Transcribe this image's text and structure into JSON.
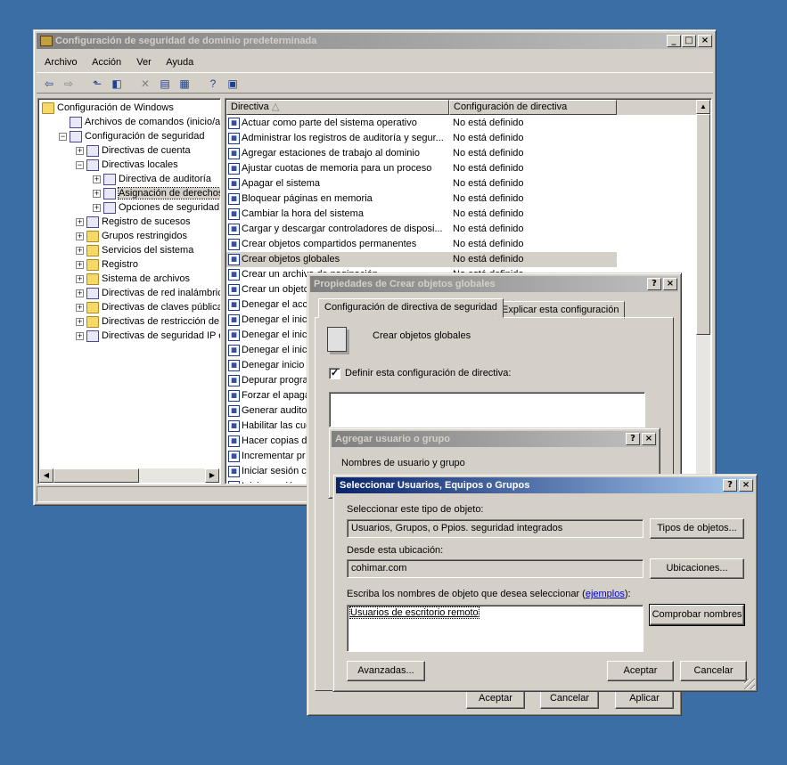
{
  "main": {
    "title": "Configuración de seguridad de dominio predeterminada",
    "menu": [
      "Archivo",
      "Acción",
      "Ver",
      "Ayuda"
    ],
    "tree": [
      {
        "label": "Configuración de Windows",
        "level": 0,
        "exp": "",
        "icon": "folder"
      },
      {
        "label": "Archivos de comandos (inicio/apa",
        "level": 1,
        "exp": "",
        "icon": "doc"
      },
      {
        "label": "Configuración de seguridad",
        "level": 1,
        "exp": "−",
        "icon": "policy"
      },
      {
        "label": "Directivas de cuenta",
        "level": 2,
        "exp": "+",
        "icon": "policy"
      },
      {
        "label": "Directivas locales",
        "level": 2,
        "exp": "−",
        "icon": "policy"
      },
      {
        "label": "Directiva de auditoría",
        "level": 3,
        "exp": "+",
        "icon": "policy"
      },
      {
        "label": "Asignación de derechos c",
        "level": 3,
        "exp": "+",
        "icon": "policy",
        "selected": true
      },
      {
        "label": "Opciones de seguridad",
        "level": 3,
        "exp": "+",
        "icon": "policy"
      },
      {
        "label": "Registro de sucesos",
        "level": 2,
        "exp": "+",
        "icon": "policy"
      },
      {
        "label": "Grupos restringidos",
        "level": 2,
        "exp": "+",
        "icon": "folder"
      },
      {
        "label": "Servicios del sistema",
        "level": 2,
        "exp": "+",
        "icon": "folder"
      },
      {
        "label": "Registro",
        "level": 2,
        "exp": "+",
        "icon": "folder"
      },
      {
        "label": "Sistema de archivos",
        "level": 2,
        "exp": "+",
        "icon": "folder"
      },
      {
        "label": "Directivas de red inalámbrica",
        "level": 2,
        "exp": "+",
        "icon": "antenna"
      },
      {
        "label": "Directivas de claves públicas",
        "level": 2,
        "exp": "+",
        "icon": "folder"
      },
      {
        "label": "Directivas de restricción de so",
        "level": 2,
        "exp": "+",
        "icon": "folder"
      },
      {
        "label": "Directivas de seguridad IP en",
        "level": 2,
        "exp": "+",
        "icon": "shield"
      }
    ],
    "list_headers": [
      "Directiva",
      "Configuración de directiva"
    ],
    "rows": [
      [
        "Actuar como parte del sistema operativo",
        "No está definido"
      ],
      [
        "Administrar los registros de auditoría y segur...",
        "No está definido"
      ],
      [
        "Agregar estaciones de trabajo al dominio",
        "No está definido"
      ],
      [
        "Ajustar cuotas de memoria para un proceso",
        "No está definido"
      ],
      [
        "Apagar el sistema",
        "No está definido"
      ],
      [
        "Bloquear páginas en memoria",
        "No está definido"
      ],
      [
        "Cambiar la hora del sistema",
        "No está definido"
      ],
      [
        "Cargar y descargar controladores de disposi...",
        "No está definido"
      ],
      [
        "Crear objetos compartidos permanentes",
        "No está definido"
      ],
      [
        "Crear objetos globales",
        "No está definido"
      ],
      [
        "Crear un archivo de paginación",
        "No está definido"
      ],
      [
        "Crear un objeto",
        ""
      ],
      [
        "Denegar el acce",
        ""
      ],
      [
        "Denegar el inici",
        ""
      ],
      [
        "Denegar el inici",
        ""
      ],
      [
        "Denegar el inici",
        ""
      ],
      [
        "Denegar inicio c",
        ""
      ],
      [
        "Depurar progra",
        ""
      ],
      [
        "Forzar el apaga",
        ""
      ],
      [
        "Generar audito",
        ""
      ],
      [
        "Habilitar las cue",
        ""
      ],
      [
        "Hacer copias de",
        ""
      ],
      [
        "Incrementar pr",
        ""
      ],
      [
        "Iniciar sesión c",
        ""
      ],
      [
        "Iniciar sesión c",
        ""
      ]
    ],
    "selected_row": 9
  },
  "props": {
    "title": "Propiedades de Crear objetos globales",
    "tabs": [
      "Configuración de directiva de seguridad",
      "Explicar esta configuración"
    ],
    "policy_name": "Crear objetos globales",
    "define_label": "Definir esta configuración de directiva:",
    "define_checked": true,
    "ok": "Aceptar",
    "cancel": "Cancelar",
    "apply": "Aplicar"
  },
  "add": {
    "title": "Agregar usuario o grupo",
    "label": "Nombres de usuario y grupo"
  },
  "select": {
    "title": "Seleccionar Usuarios, Equipos o Grupos",
    "type_label": "Seleccionar este tipo de objeto:",
    "type_value": "Usuarios, Grupos, o Ppios. seguridad integrados",
    "types_btn": "Tipos de objetos...",
    "loc_label": "Desde esta ubicación:",
    "loc_value": "cohimar.com",
    "loc_btn": "Ubicaciones...",
    "names_label": "Escriba los nombres de objeto que desea seleccionar (",
    "names_link": "ejemplos",
    "names_close": "):",
    "names_value": "Usuarios de escritorio remoto",
    "check_btn": "Comprobar nombres",
    "adv_btn": "Avanzadas...",
    "ok": "Aceptar",
    "cancel": "Cancelar"
  }
}
